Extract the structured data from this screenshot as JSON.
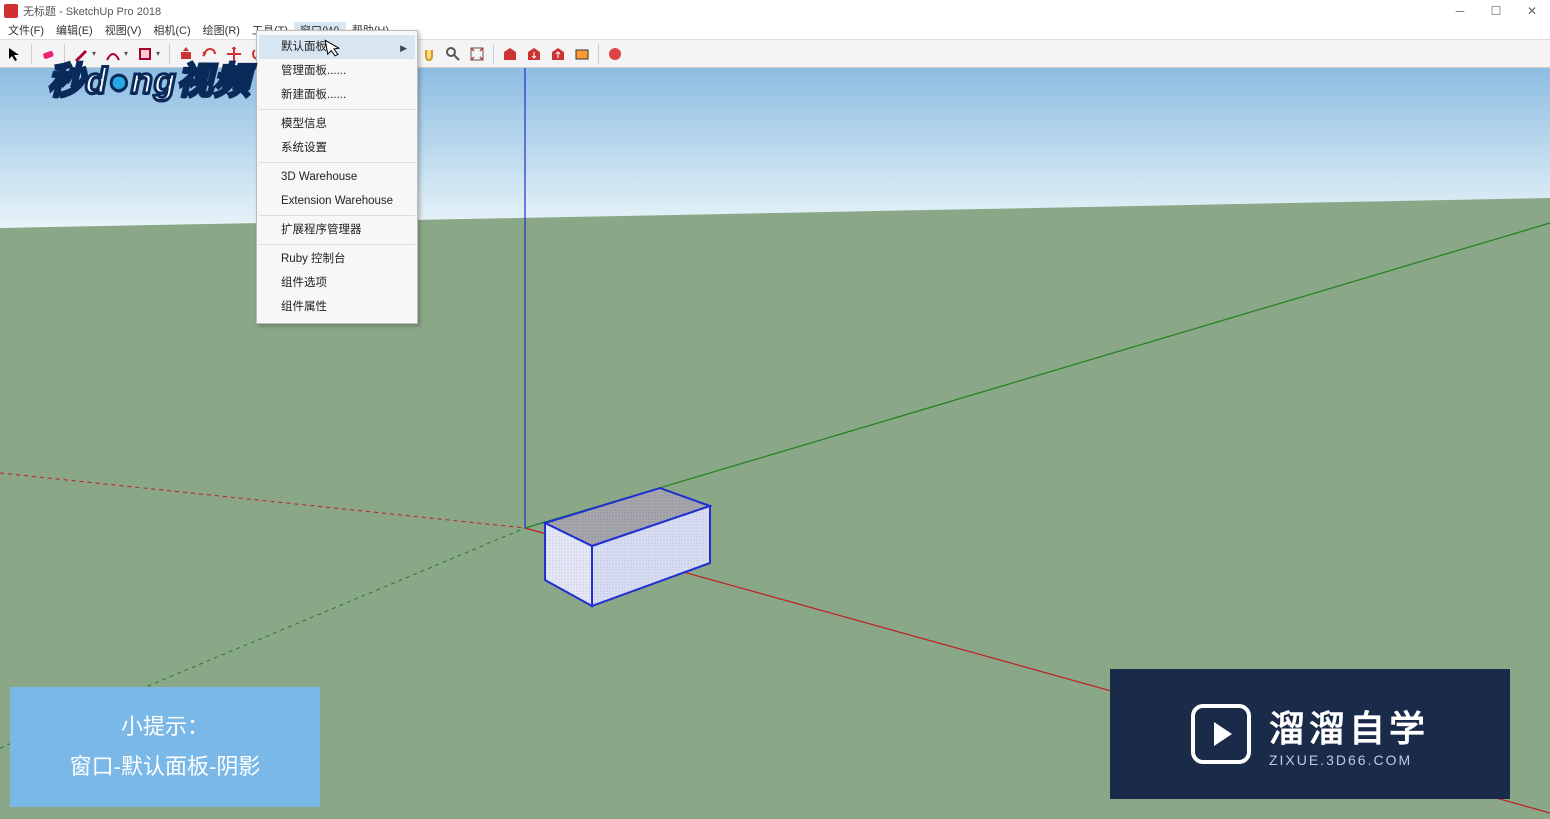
{
  "title": "无标题 - SketchUp Pro 2018",
  "menubar": {
    "file": "文件(F)",
    "edit": "编辑(E)",
    "view": "视图(V)",
    "camera": "相机(C)",
    "draw": "绘图(R)",
    "tools": "工具(T)",
    "window": "窗口(W)",
    "help": "帮助(H)"
  },
  "toolbar_icons": {
    "select": "select-tool",
    "eraser": "eraser-tool",
    "pencil": "pencil-tool",
    "arc": "arc-tool",
    "rect": "rectangle-tool",
    "circle": "circle-tool",
    "polygon": "polygon-tool",
    "pushpull": "push-pull-tool",
    "move": "move-tool",
    "rotate": "rotate-tool",
    "scale": "scale-tool",
    "offset": "offset-tool",
    "tape": "tape-measure-tool",
    "text": "text-tool",
    "paint": "paint-bucket-tool",
    "orbit": "orbit-tool",
    "pan": "pan-tool",
    "zoom": "zoom-tool",
    "zoom_extents": "zoom-extents-tool",
    "warehouse1": "3d-warehouse-tool",
    "warehouse2": "get-models-tool",
    "warehouse3": "share-model-tool",
    "ext_warehouse": "extension-warehouse-tool",
    "layout": "layout-tool"
  },
  "dropdown": {
    "default_tray": "默认面板",
    "manage_trays": "管理面板......",
    "new_tray": "新建面板......",
    "model_info": "模型信息",
    "preferences": "系统设置",
    "warehouse_3d": "3D Warehouse",
    "ext_warehouse": "Extension Warehouse",
    "ext_manager": "扩展程序管理器",
    "ruby_console": "Ruby 控制台",
    "component_options": "组件选项",
    "component_attributes": "组件属性"
  },
  "watermark": {
    "part1": "秒d",
    "part2": "ng",
    "part3": "视频"
  },
  "tip": {
    "title": "小提示：",
    "body": "窗口-默认面板-阴影"
  },
  "bottom_logo": {
    "cn": "溜溜自学",
    "en": "ZIXUE.3D66.COM"
  },
  "scene": {
    "ground_color": "#8aa888",
    "sky_top": "#8dbde2",
    "sky_horizon": "#e8f4f8",
    "axis_red": "#c02020",
    "axis_green": "#208020",
    "axis_blue": "#2030d0",
    "box_edge": "#2030d0",
    "box_top": "#a8a8a8",
    "box_front": "#e6e8f4"
  }
}
